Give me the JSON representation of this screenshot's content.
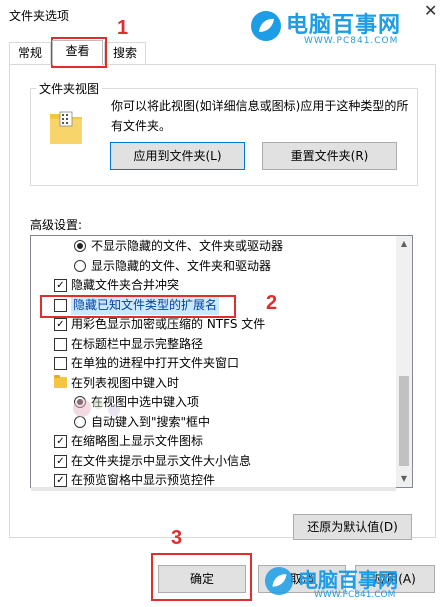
{
  "window": {
    "title": "文件夹选项",
    "close_glyph": "✕"
  },
  "watermark": {
    "name": "电脑百事网",
    "url": "WWW.PC841.COM"
  },
  "watermark_bottom": {
    "name": "电脑百事网",
    "url": "WWW.PC841.COM"
  },
  "tabs": [
    {
      "label": "常规"
    },
    {
      "label": "查看"
    },
    {
      "label": "搜索"
    }
  ],
  "annotations": {
    "step1": "1",
    "step2": "2",
    "step3": "3"
  },
  "folder_views": {
    "label": "文件夹视图",
    "description": "你可以将此视图(如详细信息或图标)应用于这种类型的所有文件夹。",
    "apply_button": "应用到文件夹(L)",
    "reset_button": "重置文件夹(R)"
  },
  "advanced": {
    "label": "高级设置:",
    "items": [
      {
        "type": "radio",
        "checked": true,
        "indent": 1,
        "label": "不显示隐藏的文件、文件夹或驱动器"
      },
      {
        "type": "radio",
        "checked": false,
        "indent": 1,
        "label": "显示隐藏的文件、文件夹和驱动器"
      },
      {
        "type": "checkbox",
        "checked": true,
        "indent": 0,
        "label": "隐藏文件夹合并冲突"
      },
      {
        "type": "checkbox",
        "checked": false,
        "indent": 0,
        "label": "隐藏已知文件类型的扩展名",
        "selected": true
      },
      {
        "type": "checkbox",
        "checked": true,
        "indent": 0,
        "label": "用彩色显示加密或压缩的 NTFS 文件"
      },
      {
        "type": "checkbox",
        "checked": false,
        "indent": 0,
        "label": "在标题栏中显示完整路径"
      },
      {
        "type": "checkbox",
        "checked": false,
        "indent": 0,
        "label": "在单独的进程中打开文件夹窗口"
      },
      {
        "type": "folder",
        "indent": 0,
        "label": "在列表视图中键入时"
      },
      {
        "type": "radio",
        "checked": true,
        "indent": 1,
        "label": "在视图中选中键入项"
      },
      {
        "type": "radio",
        "checked": false,
        "indent": 1,
        "label": "自动键入到\"搜索\"框中"
      },
      {
        "type": "checkbox",
        "checked": true,
        "indent": 0,
        "label": "在缩略图上显示文件图标"
      },
      {
        "type": "checkbox",
        "checked": true,
        "indent": 0,
        "label": "在文件夹提示中显示文件大小信息"
      },
      {
        "type": "checkbox",
        "checked": true,
        "indent": 0,
        "label": "在预览窗格中显示预览控件"
      }
    ]
  },
  "buttons": {
    "restore": "还原为默认值(D)",
    "ok": "确定",
    "cancel": "取消",
    "apply": "应用(A)"
  },
  "colors": {
    "annotation_red": "#e02d2d",
    "watermark_blue": "#1d9de6",
    "selection": "#cce8ff"
  }
}
